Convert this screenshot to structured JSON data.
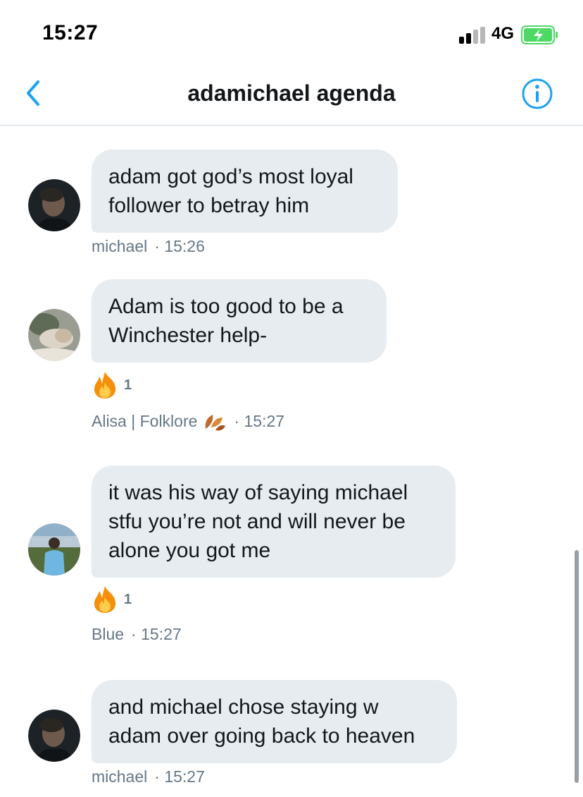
{
  "status_bar": {
    "time": "15:27",
    "network": "4G"
  },
  "header": {
    "title": "adamichael agenda"
  },
  "messages": [
    {
      "text_line1": "adam got god’s most loyal",
      "text_line2": "follower to betray him",
      "author": "michael",
      "time": "· 15:26"
    },
    {
      "text_line1": "Adam is too good to be a",
      "text_line2": "Winchester help-",
      "reaction_count": "1",
      "author": "Alisa | Folklore",
      "time": "· 15:27"
    },
    {
      "text_line1": "it was his way of saying michael",
      "text_line2": "stfu you’re not and will never be",
      "text_line3": "alone you got me",
      "reaction_count": "1",
      "author": "Blue",
      "time": "· 15:27"
    },
    {
      "text_line1": "and michael chose staying w",
      "text_line2": "adam over going back to heaven",
      "author": "michael",
      "time": "· 15:27"
    }
  ],
  "colors": {
    "accent": "#1da1f2",
    "bubble": "#e6ecf0",
    "meta_text": "#657786",
    "battery_green": "#4cd964"
  },
  "icons": {
    "back": "chevron-left-icon",
    "info": "info-icon",
    "reaction": "fire-icon",
    "author_badge": "leaves-icon"
  }
}
